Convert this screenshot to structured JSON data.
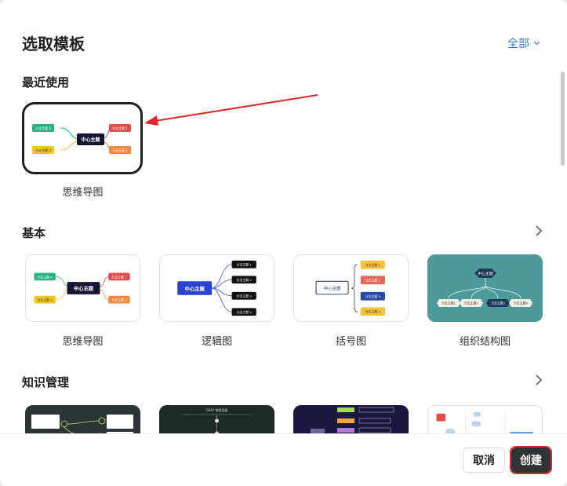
{
  "dialog": {
    "title": "选取模板",
    "filter_label": "全部"
  },
  "recent": {
    "title": "最近使用",
    "items": [
      {
        "label": "思维导图"
      }
    ]
  },
  "basic": {
    "title": "基本",
    "items": [
      {
        "label": "思维导图"
      },
      {
        "label": "逻辑图"
      },
      {
        "label": "括号图"
      },
      {
        "label": "组织结构图"
      }
    ]
  },
  "knowledge": {
    "title": "知识管理"
  },
  "thumbs": {
    "center": "中心主题",
    "b1": "分支主题 1",
    "b2": "分支主题 2",
    "b3": "分支主题 3",
    "b4": "分支主题 4",
    "b1_short": "分支主题1",
    "b2_short": "分支主题2",
    "b3_short": "分支主题3",
    "b4_short": "分支主题4",
    "k2_title": "GRAY 笔图层级"
  },
  "footer": {
    "cancel_label": "取消",
    "create_label": "创建"
  },
  "colors": {
    "accent": "#3a7bd5",
    "annotation_red": "#e0262b",
    "dark_button": "#2f3437",
    "org_teal": "#4e9a9b"
  }
}
